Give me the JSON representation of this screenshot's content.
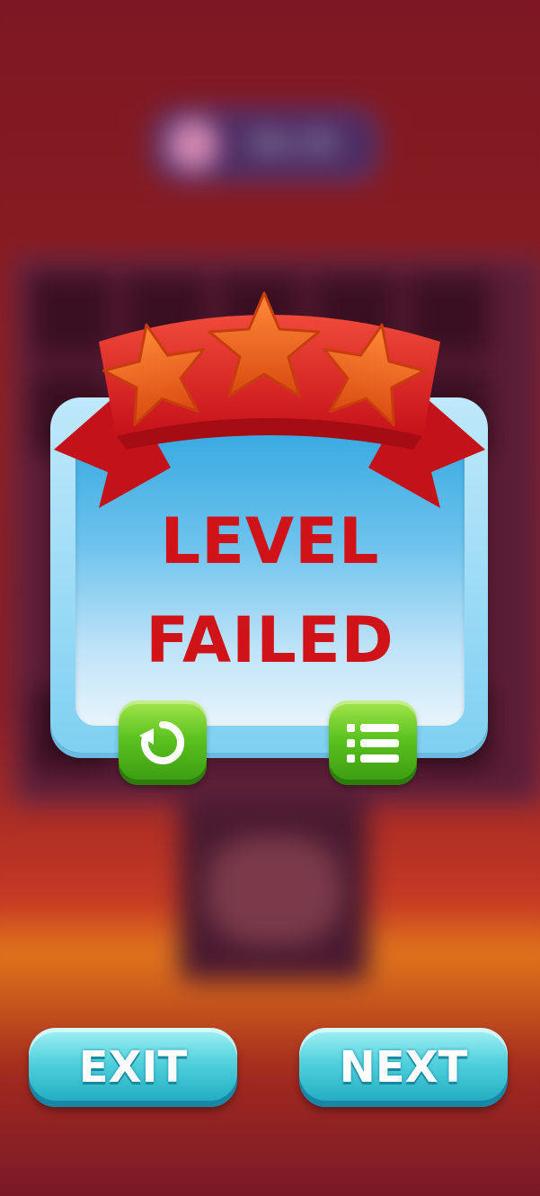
{
  "background": {
    "timer_text": "00:05"
  },
  "dialog": {
    "title_line1": "LEVEL",
    "title_line2": "FAILED",
    "stars_count": 3,
    "stars_earned": 0
  },
  "buttons": {
    "replay_icon": "replay-icon",
    "menu_icon": "menu-list-icon",
    "exit_label": "EXIT",
    "next_label": "NEXT"
  },
  "colors": {
    "title": "#d01219",
    "ribbon": "#d4141e",
    "star": "#e8621c",
    "green_button": "#5bc21f",
    "cyan_button": "#4fd0dc"
  }
}
